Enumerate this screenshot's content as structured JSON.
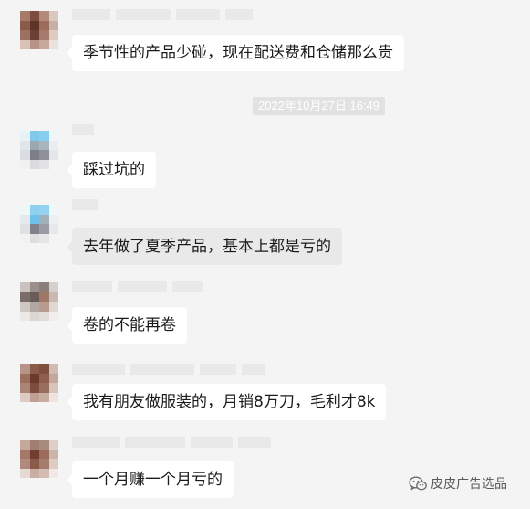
{
  "timestamp": "2022年10月27日 16:49",
  "messages": [
    {
      "id": "m1",
      "text": "季节性的产品少碰，现在配送费和仓储那么贵",
      "avatar": "avatar-brown-1"
    },
    {
      "id": "m2",
      "text": "踩过坑的",
      "avatar": "avatar-blue-1"
    },
    {
      "id": "m3",
      "text": "去年做了夏季产品，基本上都是亏的",
      "avatar": "avatar-blue-2"
    },
    {
      "id": "m4",
      "text": "卷的不能再卷",
      "avatar": "avatar-grey-1"
    },
    {
      "id": "m5",
      "text": "我有朋友做服装的，月销8万刀，毛利才8k",
      "avatar": "avatar-brown-2"
    },
    {
      "id": "m6",
      "text": "一个月赚一个月亏的",
      "avatar": "avatar-brown-3"
    }
  ],
  "watermark": {
    "text": "皮皮广告选品",
    "icon": "wechat-icon"
  },
  "colors": {
    "background": "#f4f4f4",
    "bubble": "#ffffff",
    "bubble_selected": "#e9e9e9",
    "timestamp_bg": "#e2e2e2"
  }
}
